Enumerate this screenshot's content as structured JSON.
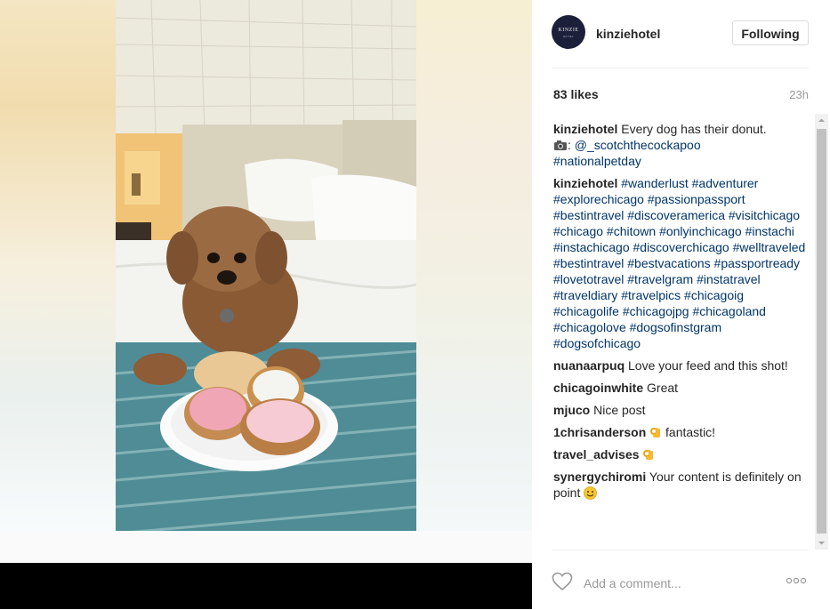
{
  "post": {
    "username": "kinziehotel",
    "follow_label": "Following",
    "avatar": {
      "logo_text": "KINZIE",
      "logo_sub": "HOTEL"
    },
    "likes": "83 likes",
    "time": "23h",
    "add_comment_placeholder": "Add a comment..."
  },
  "caption": {
    "username": "kinziehotel",
    "text": " Every dog has their donut.",
    "line2_prefix": ": ",
    "line2_mention": "@_scotchthecockapoo",
    "line3_hashtag": "#nationalpetday"
  },
  "hashtag_comment": {
    "username": "kinziehotel",
    "tags": "#wanderlust #adventurer #explorechicago #passionpassport #bestintravel #discoveramerica #visitchicago #chicago #chitown #onlyinchicago #instachi #instachicago #discoverchicago #welltraveled #bestintravel #bestvacations #passportready #lovetotravel #travelgram #instatravel #traveldiary #travelpics #chicagoig #chicagolife #chicagojpg #chicagoland #chicagolove #dogsofinstgram #dogsofchicago"
  },
  "comments": [
    {
      "username": "nuanaarpuq",
      "text": " Love your feed and this shot!"
    },
    {
      "username": "chicagoinwhite",
      "text": " Great"
    },
    {
      "username": "mjuco",
      "text": " Nice post"
    },
    {
      "username": "1chrisanderson",
      "text": " fantastic!"
    },
    {
      "username": "travel_advises",
      "text": " "
    },
    {
      "username": "synergychiromi",
      "text": " Your content is definitely on point "
    }
  ],
  "icons": {
    "heart": "heart-outline-icon",
    "more": "ellipsis-icon",
    "camera": "camera-emoji",
    "ok": "ok-hand-emoji",
    "smile": "smiley-emoji"
  },
  "colors": {
    "hashtag": "#003569",
    "text": "#262626",
    "muted": "#999999",
    "border": "#dbdbdb"
  }
}
